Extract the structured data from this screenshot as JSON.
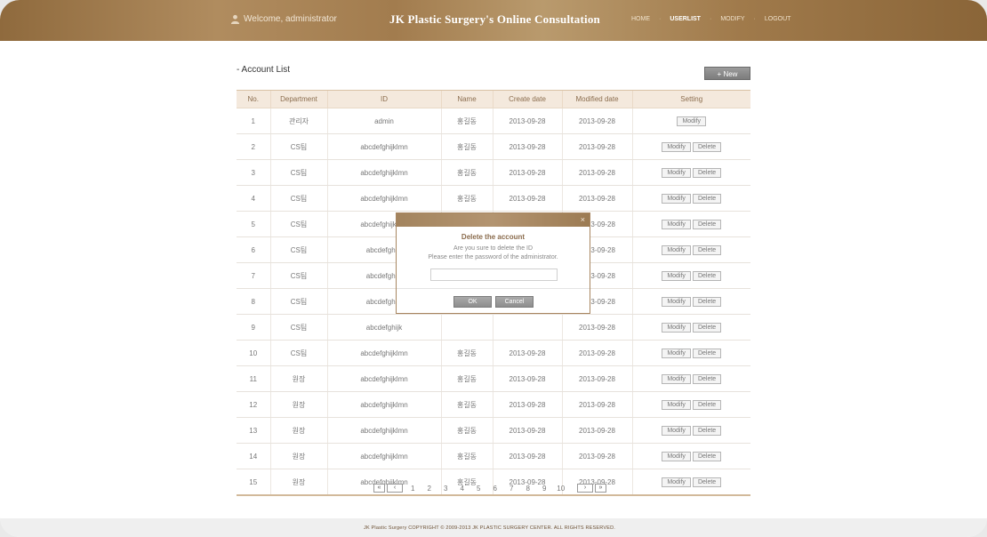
{
  "header": {
    "welcome": "Welcome, administrator",
    "title": "JK Plastic Surgery's Online Consultation",
    "nav": [
      {
        "label": "HOME",
        "active": false
      },
      {
        "label": "USERLIST",
        "active": true
      },
      {
        "label": "MODIFY",
        "active": false
      },
      {
        "label": "LOGOUT",
        "active": false
      }
    ]
  },
  "main": {
    "section_title": "- Account List",
    "new_button": "+ New",
    "columns": [
      "No.",
      "Department",
      "ID",
      "Name",
      "Create date",
      "Modified date",
      "Setting"
    ],
    "rows": [
      {
        "no": "1",
        "dept": "관리자",
        "id": "admin",
        "name": "홍길동",
        "created": "2013-09-28",
        "modified": "2013-09-28",
        "actions": [
          "Modify"
        ]
      },
      {
        "no": "2",
        "dept": "CS팀",
        "id": "abcdefghijklmn",
        "name": "홍길동",
        "created": "2013-09-28",
        "modified": "2013-09-28",
        "actions": [
          "Modify",
          "Delete"
        ]
      },
      {
        "no": "3",
        "dept": "CS팀",
        "id": "abcdefghijklmn",
        "name": "홍길동",
        "created": "2013-09-28",
        "modified": "2013-09-28",
        "actions": [
          "Modify",
          "Delete"
        ]
      },
      {
        "no": "4",
        "dept": "CS팀",
        "id": "abcdefghijklmn",
        "name": "홍길동",
        "created": "2013-09-28",
        "modified": "2013-09-28",
        "actions": [
          "Modify",
          "Delete"
        ]
      },
      {
        "no": "5",
        "dept": "CS팀",
        "id": "abcdefghijklmn",
        "name": "",
        "created": "",
        "modified": "2013-09-28",
        "actions": [
          "Modify",
          "Delete"
        ]
      },
      {
        "no": "6",
        "dept": "CS팀",
        "id": "abcdefghijk",
        "name": "",
        "created": "",
        "modified": "2013-09-28",
        "actions": [
          "Modify",
          "Delete"
        ]
      },
      {
        "no": "7",
        "dept": "CS팀",
        "id": "abcdefghijk",
        "name": "",
        "created": "",
        "modified": "2013-09-28",
        "actions": [
          "Modify",
          "Delete"
        ]
      },
      {
        "no": "8",
        "dept": "CS팀",
        "id": "abcdefghijk",
        "name": "",
        "created": "",
        "modified": "2013-09-28",
        "actions": [
          "Modify",
          "Delete"
        ]
      },
      {
        "no": "9",
        "dept": "CS팀",
        "id": "abcdefghijk",
        "name": "",
        "created": "",
        "modified": "2013-09-28",
        "actions": [
          "Modify",
          "Delete"
        ]
      },
      {
        "no": "10",
        "dept": "CS팀",
        "id": "abcdefghijklmn",
        "name": "홍길동",
        "created": "2013-09-28",
        "modified": "2013-09-28",
        "actions": [
          "Modify",
          "Delete"
        ]
      },
      {
        "no": "11",
        "dept": "원장",
        "id": "abcdefghijklmn",
        "name": "홍길동",
        "created": "2013-09-28",
        "modified": "2013-09-28",
        "actions": [
          "Modify",
          "Delete"
        ]
      },
      {
        "no": "12",
        "dept": "원장",
        "id": "abcdefghijklmn",
        "name": "홍길동",
        "created": "2013-09-28",
        "modified": "2013-09-28",
        "actions": [
          "Modify",
          "Delete"
        ]
      },
      {
        "no": "13",
        "dept": "원장",
        "id": "abcdefghijklmn",
        "name": "홍길동",
        "created": "2013-09-28",
        "modified": "2013-09-28",
        "actions": [
          "Modify",
          "Delete"
        ]
      },
      {
        "no": "14",
        "dept": "원장",
        "id": "abcdefghijklmn",
        "name": "홍길동",
        "created": "2013-09-28",
        "modified": "2013-09-28",
        "actions": [
          "Modify",
          "Delete"
        ]
      },
      {
        "no": "15",
        "dept": "원장",
        "id": "abcdefghijklmn",
        "name": "홍길동",
        "created": "2013-09-28",
        "modified": "2013-09-28",
        "actions": [
          "Modify",
          "Delete"
        ]
      }
    ]
  },
  "pagination": {
    "first": "«",
    "prev": "‹",
    "pages": [
      "1",
      "2",
      "3",
      "4",
      "5",
      "6",
      "7",
      "8",
      "9",
      "10"
    ],
    "next": "›",
    "last": "»"
  },
  "modal": {
    "close": "×",
    "title": "Delete the account",
    "line1": "Are you sure to delete the ID",
    "line2": "Please enter the password of the administrator.",
    "password_value": "",
    "ok": "OK",
    "cancel": "Cancel"
  },
  "footer": {
    "text": "JK Plastic Surgery  COPYRIGHT © 2009-2013 JK PLASTIC SURGERY CENTER. ALL RIGHTS RESERVED."
  },
  "colors": {
    "header_brown": "#a27c4e",
    "table_header_bg": "#f4e9dd",
    "accent_text": "#8b6d4e"
  }
}
